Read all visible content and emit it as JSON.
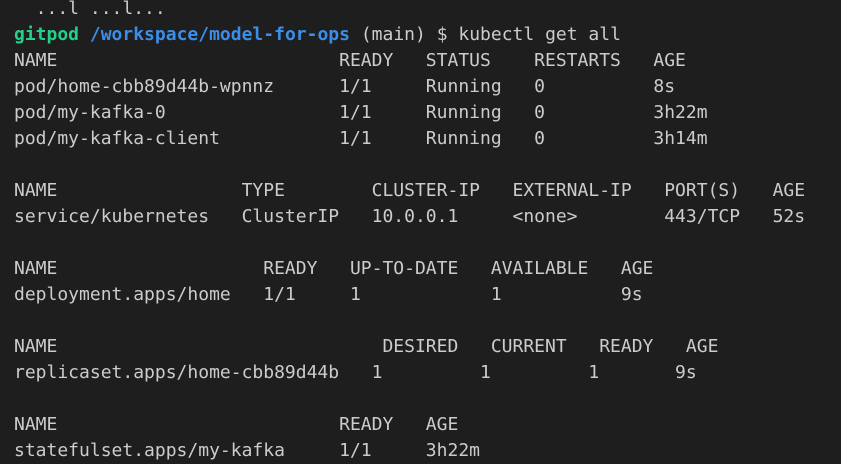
{
  "terminal": {
    "partial_top_line": "  ...l ...l...",
    "prompt": {
      "user": "gitpod",
      "path": "/workspace/model-for-ops",
      "branch": "(main)",
      "symbol": "$",
      "command": "kubectl get all"
    },
    "lines": [
      "NAME                          READY   STATUS    RESTARTS   AGE",
      "pod/home-cbb89d44b-wpnnz      1/1     Running   0          8s",
      "pod/my-kafka-0                1/1     Running   0          3h22m",
      "pod/my-kafka-client           1/1     Running   0          3h14m",
      "",
      "NAME                 TYPE        CLUSTER-IP   EXTERNAL-IP   PORT(S)   AGE",
      "service/kubernetes   ClusterIP   10.0.0.1     <none>        443/TCP   52s",
      "",
      "NAME                   READY   UP-TO-DATE   AVAILABLE   AGE",
      "deployment.apps/home   1/1     1            1           9s",
      "",
      "NAME                              DESIRED   CURRENT   READY   AGE",
      "replicaset.apps/home-cbb89d44b   1         1         1       9s",
      "",
      "NAME                          READY   AGE",
      "statefulset.apps/my-kafka     1/1     3h22m"
    ]
  },
  "colors": {
    "background": "#1e1e1e",
    "foreground": "#cccccc",
    "prompt_user": "#23d18b",
    "prompt_path": "#3b8eea"
  }
}
